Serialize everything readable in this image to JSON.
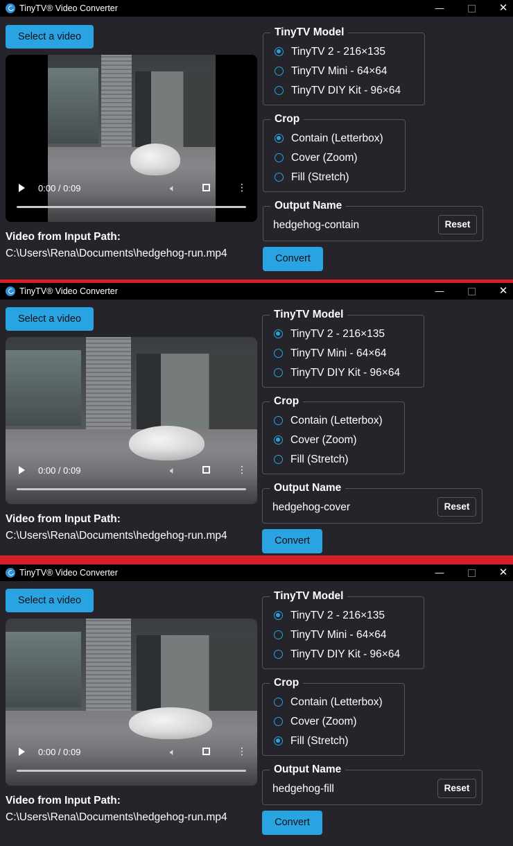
{
  "windows": [
    {
      "title": "TinyTV® Video Converter",
      "select_button": "Select a video",
      "video_time": "0:00 / 0:09",
      "path_label": "Video from Input Path:",
      "path_value": "C:\\Users\\Rena\\Documents\\hedgehog-run.mp4",
      "model_legend": "TinyTV Model",
      "models": [
        {
          "label": "TinyTV 2 - 216×135",
          "selected": true
        },
        {
          "label": "TinyTV Mini - 64×64",
          "selected": false
        },
        {
          "label": "TinyTV DIY Kit - 96×64",
          "selected": false
        }
      ],
      "crop_legend": "Crop",
      "crops": [
        {
          "label": "Contain (Letterbox)",
          "selected": true
        },
        {
          "label": "Cover (Zoom)",
          "selected": false
        },
        {
          "label": "Fill (Stretch)",
          "selected": false
        }
      ],
      "output_legend": "Output Name",
      "output_value": "hedgehog-contain",
      "reset_button": "Reset",
      "convert_button": "Convert",
      "video_mode": "contain"
    },
    {
      "title": "TinyTV® Video Converter",
      "select_button": "Select a video",
      "video_time": "0:00 / 0:09",
      "path_label": "Video from Input Path:",
      "path_value": "C:\\Users\\Rena\\Documents\\hedgehog-run.mp4",
      "model_legend": "TinyTV Model",
      "models": [
        {
          "label": "TinyTV 2 - 216×135",
          "selected": true
        },
        {
          "label": "TinyTV Mini - 64×64",
          "selected": false
        },
        {
          "label": "TinyTV DIY Kit - 96×64",
          "selected": false
        }
      ],
      "crop_legend": "Crop",
      "crops": [
        {
          "label": "Contain (Letterbox)",
          "selected": false
        },
        {
          "label": "Cover (Zoom)",
          "selected": true
        },
        {
          "label": "Fill (Stretch)",
          "selected": false
        }
      ],
      "output_legend": "Output Name",
      "output_value": "hedgehog-cover",
      "reset_button": "Reset",
      "convert_button": "Convert",
      "video_mode": "cover"
    },
    {
      "title": "TinyTV® Video Converter",
      "select_button": "Select a video",
      "video_time": "0:00 / 0:09",
      "path_label": "Video from Input Path:",
      "path_value": "C:\\Users\\Rena\\Documents\\hedgehog-run.mp4",
      "model_legend": "TinyTV Model",
      "models": [
        {
          "label": "TinyTV 2 - 216×135",
          "selected": true
        },
        {
          "label": "TinyTV Mini - 64×64",
          "selected": false
        },
        {
          "label": "TinyTV DIY Kit - 96×64",
          "selected": false
        }
      ],
      "crop_legend": "Crop",
      "crops": [
        {
          "label": "Contain (Letterbox)",
          "selected": false
        },
        {
          "label": "Cover (Zoom)",
          "selected": false
        },
        {
          "label": "Fill (Stretch)",
          "selected": true
        }
      ],
      "output_legend": "Output Name",
      "output_value": "hedgehog-fill",
      "reset_button": "Reset",
      "convert_button": "Convert",
      "video_mode": "fill"
    }
  ],
  "icons": {
    "app": "tinytv-app-icon",
    "minimize": "minimize-icon",
    "maximize": "maximize-icon",
    "close": "close-icon",
    "play": "play-icon",
    "volume": "volume-icon",
    "fullscreen": "fullscreen-icon",
    "more": "more-options-icon"
  },
  "colors": {
    "accent": "#2aa3e3",
    "window_bg": "#24242a",
    "titlebar_bg": "#000000",
    "separator": "#d61f26"
  }
}
